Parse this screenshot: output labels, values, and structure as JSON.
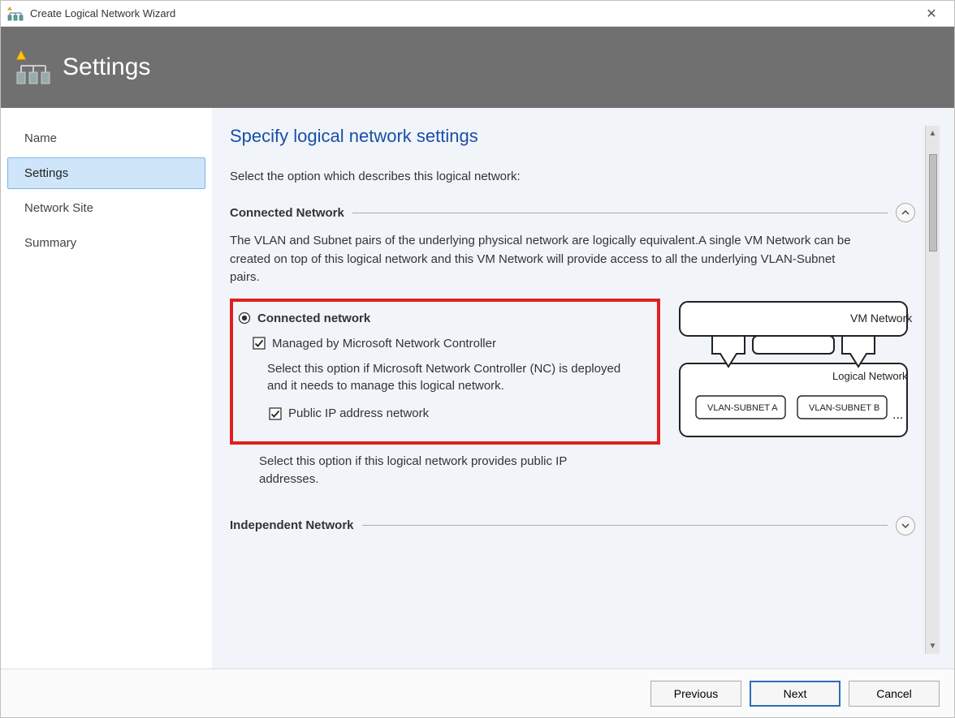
{
  "window": {
    "title": "Create Logical Network Wizard"
  },
  "banner": {
    "title": "Settings"
  },
  "sidebar": {
    "items": [
      {
        "label": "Name",
        "selected": false
      },
      {
        "label": "Settings",
        "selected": true
      },
      {
        "label": "Network Site",
        "selected": false
      },
      {
        "label": "Summary",
        "selected": false
      }
    ]
  },
  "page": {
    "title": "Specify logical network settings",
    "prompt": "Select the option which describes this logical network:"
  },
  "sections": {
    "connected": {
      "title": "Connected Network",
      "desc": "The VLAN and Subnet pairs of the underlying physical network are logically equivalent.A single VM Network can be created on top of this logical network and this VM Network will provide access to all the underlying VLAN-Subnet pairs.",
      "radio_label": "Connected network",
      "managed_label": "Managed by Microsoft Network Controller",
      "managed_desc": "Select this option if Microsoft Network Controller (NC) is deployed and it needs to manage this logical network.",
      "publicip_label": "Public IP address network",
      "publicip_desc": "Select this option if this logical network provides public IP addresses."
    },
    "independent": {
      "title": "Independent Network"
    }
  },
  "diagram": {
    "vm_label": "VM Network",
    "ln_label": "Logical  Network",
    "vlan_a": "VLAN-SUBNET A",
    "vlan_b": "VLAN-SUBNET B",
    "ellipsis": "..."
  },
  "footer": {
    "previous": "Previous",
    "next": "Next",
    "cancel": "Cancel"
  }
}
